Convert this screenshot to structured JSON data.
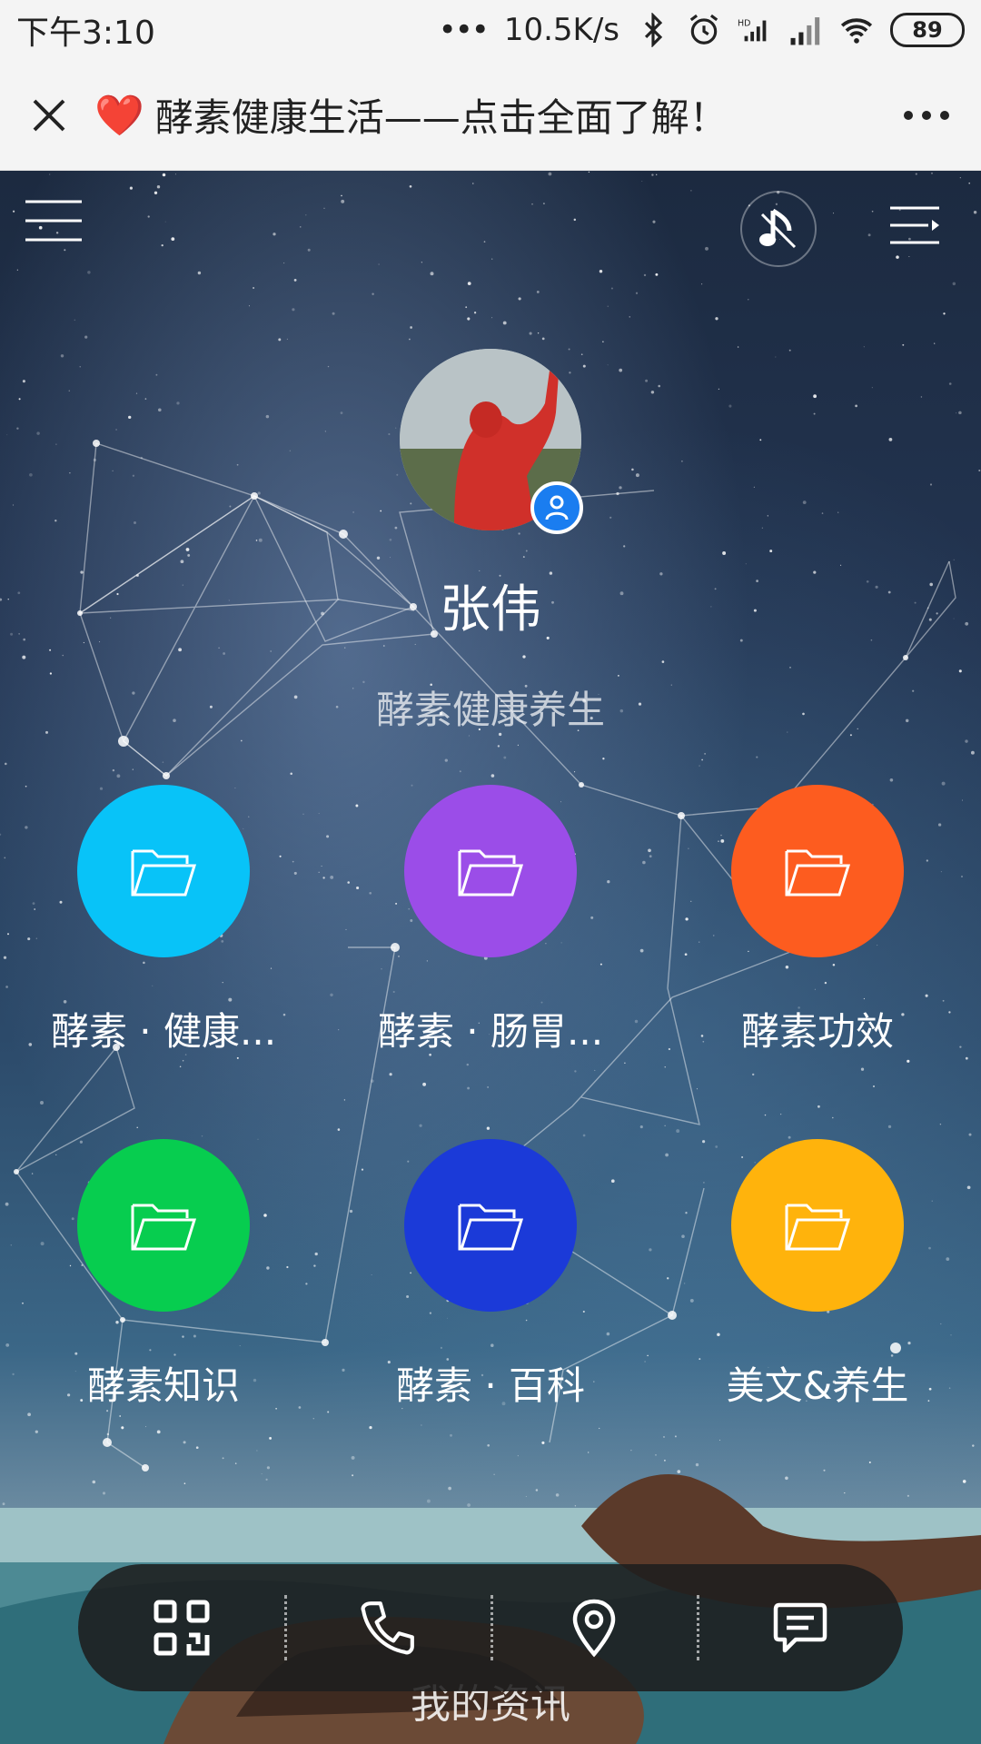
{
  "status_bar": {
    "time": "下午3:10",
    "network_speed": "10.5K/s",
    "battery": "89"
  },
  "title_bar": {
    "title": "酵素健康生活——点击全面了解！",
    "emoji": "❤️"
  },
  "profile": {
    "name": "张伟",
    "description": "酵素健康养生"
  },
  "categories": [
    {
      "label": "酵素 · 健康...",
      "color": "#08c3f8"
    },
    {
      "label": "酵素 · 肠胃...",
      "color": "#9b4de8"
    },
    {
      "label": "酵素功效",
      "color": "#fd5c1f"
    },
    {
      "label": "酵素知识",
      "color": "#07cd4f"
    },
    {
      "label": "酵素 · 百科",
      "color": "#1b3ad8"
    },
    {
      "label": "美文&养生",
      "color": "#ffb30c"
    }
  ],
  "bottom_bar": {
    "items": [
      "qr-code-icon",
      "phone-icon",
      "location-pin-icon",
      "message-icon"
    ]
  },
  "footer": {
    "text": "我的资讯"
  }
}
